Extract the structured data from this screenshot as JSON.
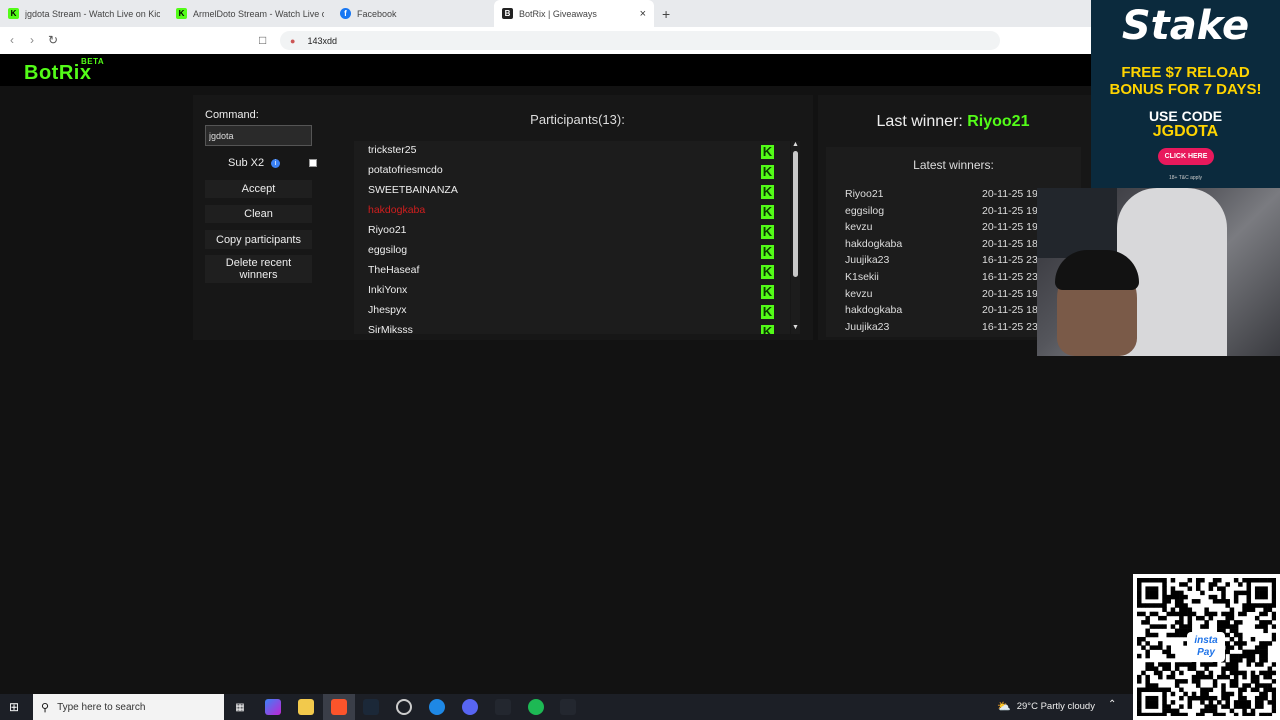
{
  "browser": {
    "tabs": [
      {
        "title": "jgdota Stream - Watch Live on Kick",
        "favicon": "kick-icon",
        "color": "#53fc18"
      },
      {
        "title": "ArmelDoto Stream - Watch Live o",
        "favicon": "kick-icon",
        "color": "#53fc18"
      },
      {
        "title": "Facebook",
        "favicon": "facebook-icon",
        "color": "#1877f2"
      },
      {
        "title": "BotRix | Giveaways",
        "favicon": "botrix-icon",
        "color": "#222222"
      }
    ],
    "new_tab": "+",
    "close": "×",
    "address": "143xdd"
  },
  "app": {
    "logo": "BotRix",
    "beta": "BETA"
  },
  "controls": {
    "command_label": "Command:",
    "command_value": "jgdota",
    "sub_label": "Sub X2",
    "info": "i",
    "accept": "Accept",
    "clean": "Clean",
    "copy": "Copy participants",
    "delete_line1": "Delete recent",
    "delete_line2": "winners"
  },
  "participants": {
    "title": "Participants(13):",
    "items": [
      {
        "name": "trickster25",
        "highlight": false
      },
      {
        "name": "potatofriesmcdo",
        "highlight": false
      },
      {
        "name": "SWEETBAINANZA",
        "highlight": false
      },
      {
        "name": "hakdogkaba",
        "highlight": true
      },
      {
        "name": "Riyoo21",
        "highlight": false
      },
      {
        "name": "eggsilog",
        "highlight": false
      },
      {
        "name": "TheHaseaf",
        "highlight": false
      },
      {
        "name": "InkiYonx",
        "highlight": false
      },
      {
        "name": "Jhespyx",
        "highlight": false
      },
      {
        "name": "SirMiksss",
        "highlight": false
      }
    ],
    "platform_glyph": "K"
  },
  "winners": {
    "last_label": "Last winner:",
    "last_name": "Riyoo21",
    "latest_title": "Latest winners:",
    "items": [
      {
        "name": "Riyoo21",
        "date": "20-11-25 19"
      },
      {
        "name": "eggsilog",
        "date": "20-11-25 19"
      },
      {
        "name": "kevzu",
        "date": "20-11-25 19"
      },
      {
        "name": "hakdogkaba",
        "date": "20-11-25 18"
      },
      {
        "name": "Juujika23",
        "date": "16-11-25 23"
      },
      {
        "name": "K1sekii",
        "date": "16-11-25 23"
      },
      {
        "name": "kevzu",
        "date": "20-11-25 19"
      },
      {
        "name": "hakdogkaba",
        "date": "20-11-25 18"
      },
      {
        "name": "Juujika23",
        "date": "16-11-25 23"
      }
    ]
  },
  "ad": {
    "brand": "Stake",
    "line1": "FREE $7 RELOAD",
    "line2": "BONUS FOR 7 DAYS!",
    "use_code": "USE CODE",
    "code": "JGDOTA",
    "cta": "CLICK HERE",
    "fine": "18+ T&C apply"
  },
  "qr": {
    "badge_line1": "insta",
    "badge_line2": "Pay"
  },
  "taskbar": {
    "search_placeholder": "Type here to search",
    "weather": "29°C  Partly cloudy"
  },
  "colors": {
    "accent": "#53fc18",
    "highlight_red": "#d01e1e"
  }
}
